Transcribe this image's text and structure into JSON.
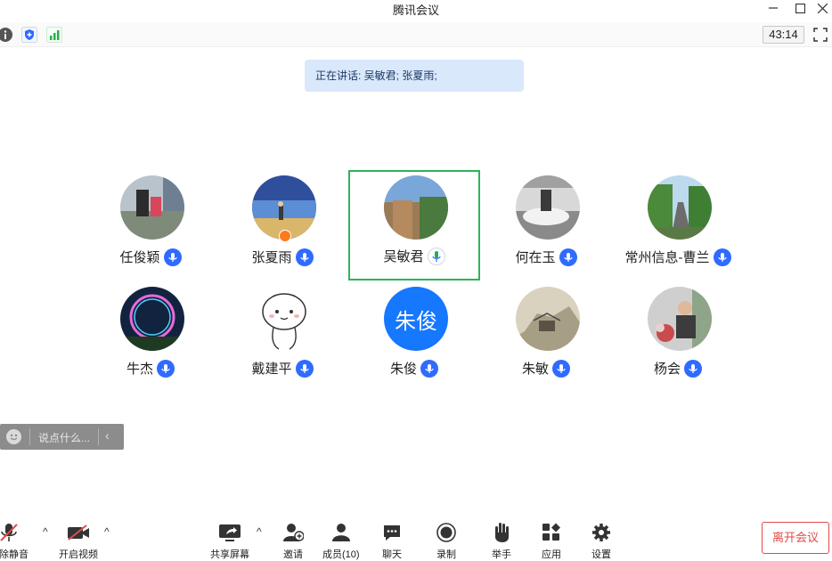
{
  "window": {
    "title": "腾讯会议"
  },
  "toolbar": {
    "timer": "43:14"
  },
  "speaking": {
    "text": "正在讲话: 吴敏君; 张夏雨;"
  },
  "participants": [
    {
      "name": "任俊颖",
      "avatar": "photo-family"
    },
    {
      "name": "张夏雨",
      "avatar": "photo-sky"
    },
    {
      "name": "吴敏君",
      "avatar": "photo-cliff"
    },
    {
      "name": "何在玉",
      "avatar": "photo-bw-car"
    },
    {
      "name": "常州信息-曹兰",
      "avatar": "photo-road"
    },
    {
      "name": "牛杰",
      "avatar": "photo-ferris-wheel"
    },
    {
      "name": "戴建平",
      "avatar": "cartoon-face"
    },
    {
      "name": "朱俊",
      "avatar": "text-avatar",
      "initials": "朱俊"
    },
    {
      "name": "朱敏",
      "avatar": "painting"
    },
    {
      "name": "杨会",
      "avatar": "photo-flowers"
    }
  ],
  "chat": {
    "placeholder": "说点什么..."
  },
  "bottom": {
    "unmute": "解除静音",
    "start_video": "开启视频",
    "share_screen": "共享屏幕",
    "invite": "邀请",
    "members": "成员(10)",
    "chat": "聊天",
    "record": "录制",
    "raise_hand": "举手",
    "apps": "应用",
    "settings": "设置",
    "leave": "离开会议"
  },
  "colors": {
    "accent": "#2f6bff",
    "active_border": "#2bb55a",
    "leave": "#e24a4a",
    "speaking_bg": "#d9e8fb"
  }
}
